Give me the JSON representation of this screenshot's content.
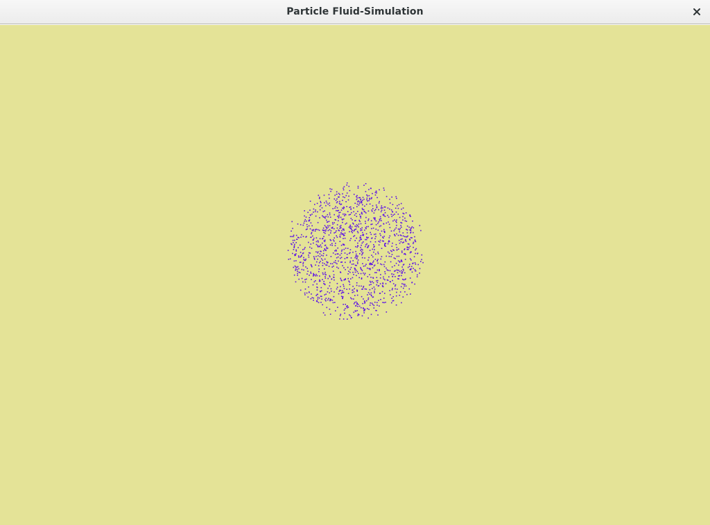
{
  "window": {
    "title": "Particle Fluid-Simulation",
    "close_icon": "close-icon"
  },
  "canvas": {
    "background_color": "#e4e397",
    "particle_color": "#5a0fe6"
  }
}
